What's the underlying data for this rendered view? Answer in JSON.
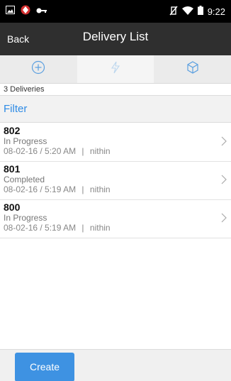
{
  "status_bar": {
    "time": "9:22",
    "left_icons": [
      "image-icon",
      "app-icon",
      "key-icon"
    ],
    "right_icons": [
      "vibrate-off-icon",
      "wifi-icon",
      "battery-icon"
    ]
  },
  "header": {
    "back_label": "Back",
    "title": "Delivery List"
  },
  "tabs": [
    {
      "icon": "plus-circle-icon",
      "active": false
    },
    {
      "icon": "lightning-icon",
      "active": true
    },
    {
      "icon": "box-icon",
      "active": false
    }
  ],
  "list": {
    "count_label": "3 Deliveries",
    "filter_label": "Filter",
    "items": [
      {
        "id": "802",
        "status": "In Progress",
        "datetime": "08-02-16 / 5:20 AM",
        "separator": "|",
        "user": "nithin"
      },
      {
        "id": "801",
        "status": "Completed",
        "datetime": "08-02-16 / 5:19 AM",
        "separator": "|",
        "user": "nithin"
      },
      {
        "id": "800",
        "status": "In Progress",
        "datetime": "08-02-16 / 5:19 AM",
        "separator": "|",
        "user": "nithin"
      }
    ]
  },
  "footer": {
    "create_label": "Create"
  },
  "colors": {
    "accent": "#2e8be5",
    "button": "#3e92e2",
    "header_bg": "#2f2f2f",
    "status_bar_bg": "#000000"
  }
}
